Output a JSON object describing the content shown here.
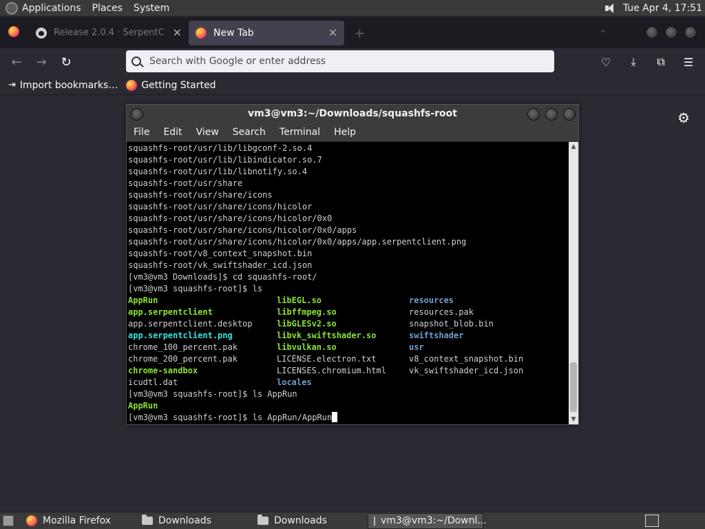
{
  "top_panel": {
    "menus": [
      "Applications",
      "Places",
      "System"
    ],
    "clock": "Tue Apr  4, 17:51"
  },
  "browser": {
    "tabs": [
      {
        "label": "Release 2.0.4 · SerpentC",
        "active": false
      },
      {
        "label": "New Tab",
        "active": true
      }
    ],
    "url_placeholder": "Search with Google or enter address",
    "bookmarks": [
      "Import bookmarks…",
      "Getting Started"
    ]
  },
  "terminal": {
    "title": "vm3@vm3:~/Downloads/squashfs-root",
    "menu": [
      "File",
      "Edit",
      "View",
      "Search",
      "Terminal",
      "Help"
    ],
    "lines_before": [
      "squashfs-root/usr/lib/libgconf-2.so.4",
      "squashfs-root/usr/lib/libindicator.so.7",
      "squashfs-root/usr/lib/libnotify.so.4",
      "squashfs-root/usr/share",
      "squashfs-root/usr/share/icons",
      "squashfs-root/usr/share/icons/hicolor",
      "squashfs-root/usr/share/icons/hicolor/0x0",
      "squashfs-root/usr/share/icons/hicolor/0x0/apps",
      "squashfs-root/usr/share/icons/hicolor/0x0/apps/app.serpentclient.png",
      "squashfs-root/v8_context_snapshot.bin",
      "squashfs-root/vk_swiftshader_icd.json",
      "[vm3@vm3 Downloads]$ cd squashfs-root/",
      "[vm3@vm3 squashfs-root]$ ls"
    ],
    "ls_rows": [
      [
        {
          "t": "AppRun",
          "c": "green"
        },
        {
          "t": "libEGL.so",
          "c": "green"
        },
        {
          "t": "resources",
          "c": "blue"
        }
      ],
      [
        {
          "t": "app.serpentclient",
          "c": "green"
        },
        {
          "t": "libffmpeg.so",
          "c": "green"
        },
        {
          "t": "resources.pak",
          "c": "plain"
        }
      ],
      [
        {
          "t": "app.serpentclient.desktop",
          "c": "plain"
        },
        {
          "t": "libGLESv2.so",
          "c": "green"
        },
        {
          "t": "snapshot_blob.bin",
          "c": "plain"
        }
      ],
      [
        {
          "t": "app.serpentclient.png",
          "c": "cyan"
        },
        {
          "t": "libvk_swiftshader.so",
          "c": "green"
        },
        {
          "t": "swiftshader",
          "c": "blue"
        }
      ],
      [
        {
          "t": "chrome_100_percent.pak",
          "c": "plain"
        },
        {
          "t": "libvulkan.so",
          "c": "green"
        },
        {
          "t": "usr",
          "c": "blue"
        }
      ],
      [
        {
          "t": "chrome_200_percent.pak",
          "c": "plain"
        },
        {
          "t": "LICENSE.electron.txt",
          "c": "plain"
        },
        {
          "t": "v8_context_snapshot.bin",
          "c": "plain"
        }
      ],
      [
        {
          "t": "chrome-sandbox",
          "c": "green"
        },
        {
          "t": "LICENSES.chromium.html",
          "c": "plain"
        },
        {
          "t": "vk_swiftshader_icd.json",
          "c": "plain"
        }
      ],
      [
        {
          "t": "icudtl.dat",
          "c": "plain"
        },
        {
          "t": "locales",
          "c": "blue"
        },
        {
          "t": "",
          "c": "plain"
        }
      ]
    ],
    "lines_after": [
      {
        "t": "[vm3@vm3 squashfs-root]$ ls AppRun",
        "c": "plain"
      },
      {
        "t": "AppRun",
        "c": "green"
      }
    ],
    "current_prompt": "[vm3@vm3 squashfs-root]$ ls AppRun/AppRun"
  },
  "taskbar": {
    "items": [
      {
        "label": "Mozilla Firefox",
        "icon": "firefox-icon"
      },
      {
        "label": "Downloads",
        "icon": "folder-icon"
      },
      {
        "label": "Downloads",
        "icon": "folder-icon"
      },
      {
        "label": "vm3@vm3:~/Downl...",
        "icon": "terminal-icon"
      }
    ]
  }
}
